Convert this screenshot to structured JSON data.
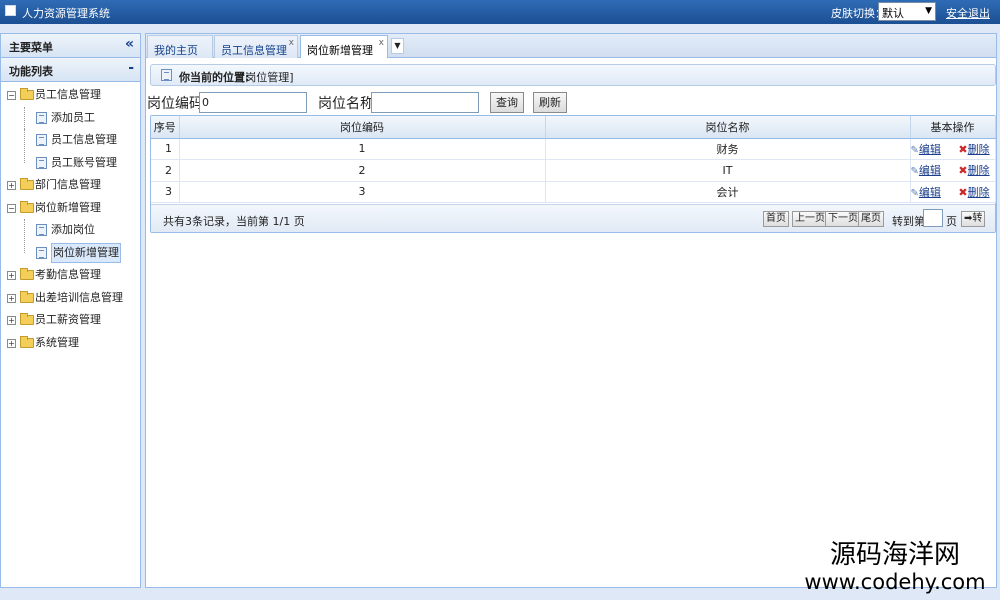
{
  "app": {
    "title": "人力资源管理系统"
  },
  "topbar": {
    "skin_label": "皮肤切换：",
    "skin_value": "默认",
    "logout": "安全退出"
  },
  "sidebar": {
    "main_menu": "主要菜单",
    "collapse_icon": "«",
    "function_list": "功能列表",
    "function_toggle": "-",
    "tree": [
      {
        "label": "员工信息管理",
        "expander": "⊟",
        "children": [
          "添加员工",
          "员工信息管理",
          "员工账号管理"
        ]
      },
      {
        "label": "部门信息管理",
        "expander": "⊞"
      },
      {
        "label": "岗位新增管理",
        "expander": "⊟",
        "children": [
          "添加岗位",
          "岗位新增管理"
        ],
        "selected_child": "岗位新增管理"
      },
      {
        "label": "考勤信息管理",
        "expander": "⊞"
      },
      {
        "label": "出差培训信息管理",
        "expander": "⊞"
      },
      {
        "label": "员工薪资管理",
        "expander": "⊞"
      },
      {
        "label": "系统管理",
        "expander": "⊞"
      }
    ]
  },
  "tabs": [
    {
      "label": "我的主页"
    },
    {
      "label": "员工信息管理",
      "close": "x"
    },
    {
      "label": "岗位新增管理",
      "close": "x",
      "active": true
    }
  ],
  "tab_menu": "▼",
  "location": {
    "label": "你当前的位置:",
    "value": "[岗位管理]"
  },
  "search": {
    "code_label": "岗位编码:",
    "code_value": "0",
    "name_label": "岗位名称:",
    "name_value": "",
    "query_button": "查询",
    "refresh_button": "刷新"
  },
  "grid": {
    "columns": [
      "序号",
      "岗位编码",
      "岗位名称",
      "基本操作"
    ],
    "rows": [
      {
        "index": "1",
        "code": "1",
        "name": "财务"
      },
      {
        "index": "2",
        "code": "2",
        "name": "IT"
      },
      {
        "index": "3",
        "code": "3",
        "name": "会计"
      }
    ],
    "edit_label": "编辑",
    "delete_label": "删除"
  },
  "pager": {
    "record_info": "共有3条记录，当前第 1/1 页",
    "first": "首页",
    "prev": "上一页",
    "next": "下一页",
    "last": "尾页",
    "goto_label": "转到第",
    "goto_value": "",
    "page_unit": "页",
    "go_button": "➡转"
  },
  "watermark": {
    "cn": "源码海洋网",
    "url": "www.codehy.com"
  },
  "colors": {
    "topbar": "#1b4f93",
    "panel_border": "#99bbe8",
    "link": "#1a3e8c"
  }
}
